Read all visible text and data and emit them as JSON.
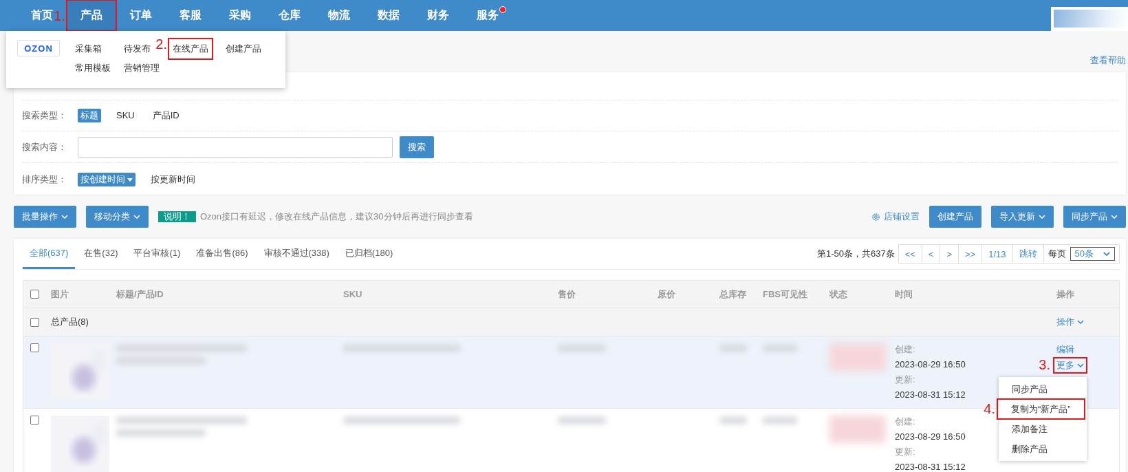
{
  "nav": {
    "items": [
      {
        "label": "首页",
        "selected": false
      },
      {
        "label": "产品",
        "selected": true,
        "annotation": "1."
      },
      {
        "label": "订单",
        "selected": false
      },
      {
        "label": "客服",
        "selected": false
      },
      {
        "label": "采购",
        "selected": false
      },
      {
        "label": "仓库",
        "selected": false
      },
      {
        "label": "物流",
        "selected": false
      },
      {
        "label": "数据",
        "selected": false
      },
      {
        "label": "财务",
        "selected": false
      },
      {
        "label": "服务",
        "selected": false,
        "badge": true
      }
    ]
  },
  "product_menu": {
    "logo": "OZON",
    "items": [
      {
        "label": "采集箱"
      },
      {
        "label": "待发布"
      },
      {
        "label": "在线产品",
        "annotation": "2."
      },
      {
        "label": "创建产品"
      },
      {
        "label": "常用模板"
      },
      {
        "label": "营销管理"
      }
    ]
  },
  "help_link": "查看帮助",
  "filters": [
    {
      "kind": "options",
      "label": "搜索类型：",
      "options": [
        {
          "label": "标题",
          "selected": true
        },
        {
          "label": "SKU",
          "selected": false
        },
        {
          "label": "产品ID",
          "selected": false
        }
      ]
    },
    {
      "kind": "search",
      "label": "搜索内容：",
      "button": "搜索"
    },
    {
      "kind": "options",
      "label": "排序类型：",
      "options": [
        {
          "label": "按创建时间",
          "selected": true,
          "dropdown": true
        },
        {
          "label": "按更新时间",
          "selected": false
        }
      ]
    }
  ],
  "toolbar": {
    "left_buttons": [
      "批量操作",
      "移动分类"
    ],
    "notice": {
      "tag": "说明！",
      "text": "Ozon接口有延迟，修改在线产品信息，建议30分钟后再进行同步查看"
    },
    "settings_link": "店铺设置",
    "right_buttons": [
      {
        "label": "创建产品",
        "dropdown": false
      },
      {
        "label": "导入更新",
        "dropdown": true
      },
      {
        "label": "同步产品",
        "dropdown": true
      }
    ]
  },
  "tabs": [
    {
      "label": "全部(637)",
      "selected": true
    },
    {
      "label": "在售(32)",
      "selected": false
    },
    {
      "label": "平台审核(1)",
      "selected": false
    },
    {
      "label": "准备出售(86)",
      "selected": false
    },
    {
      "label": "审核不通过(338)",
      "selected": false
    },
    {
      "label": "已归档(180)",
      "selected": false
    }
  ],
  "pagination": {
    "summary": "第1-50条，共637条",
    "buttons": [
      "<<",
      "<",
      ">",
      ">>",
      "1/13",
      "跳转"
    ],
    "per_page_label": "每页",
    "per_page": "50条"
  },
  "table": {
    "header_checked": false,
    "columns": [
      "图片",
      "标题/产品ID",
      "SKU",
      "售价",
      "原价",
      "总库存",
      "FBS可见性",
      "状态",
      "时间",
      "操作"
    ],
    "group_row": {
      "label": "总产品(8)",
      "checked": false,
      "action": "操作"
    },
    "rows": [
      {
        "checked": false,
        "highlighted": true,
        "created_label": "创建:",
        "created": "2023-08-29 16:50",
        "updated_label": "更新:",
        "updated": "2023-08-31 15:12",
        "edit": "编辑",
        "more": "更多",
        "more_annotation": "3."
      },
      {
        "checked": false,
        "highlighted": false,
        "created_label": "创建:",
        "created": "2023-08-29 16:50",
        "updated_label": "更新:",
        "updated": "2023-08-31 15:12"
      }
    ]
  },
  "more_menu": {
    "items": [
      {
        "label": "同步产品"
      },
      {
        "label": "复制为“新产品”",
        "annotation": "4."
      },
      {
        "label": "添加备注"
      },
      {
        "label": "删除产品"
      }
    ]
  }
}
